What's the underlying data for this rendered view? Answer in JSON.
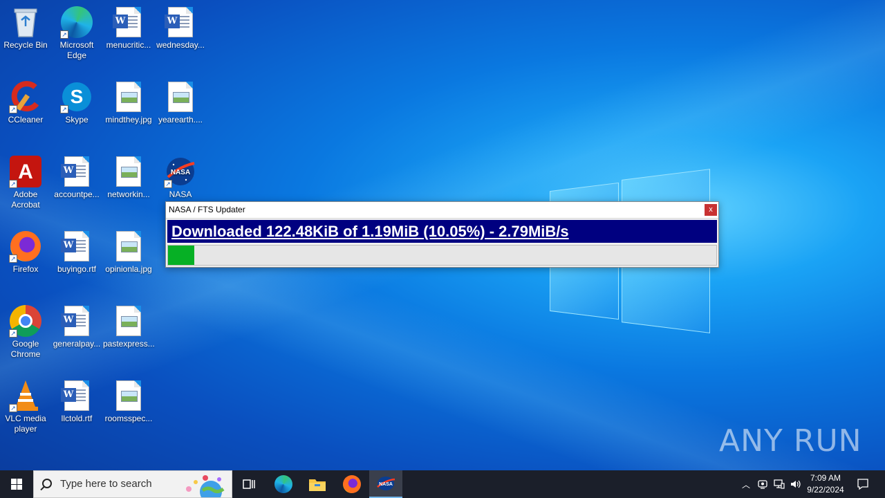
{
  "desktop": {
    "icons": [
      {
        "label": "Recycle Bin"
      },
      {
        "label": "Microsoft Edge"
      },
      {
        "label": "menucritic..."
      },
      {
        "label": "wednesday..."
      },
      {
        "label": "CCleaner"
      },
      {
        "label": "Skype"
      },
      {
        "label": "mindthey.jpg"
      },
      {
        "label": "yearearth...."
      },
      {
        "label": "Adobe Acrobat"
      },
      {
        "label": "accountpe..."
      },
      {
        "label": "networkin..."
      },
      {
        "label": "NASA"
      },
      {
        "label": "Firefox"
      },
      {
        "label": "buyingo.rtf"
      },
      {
        "label": "opinionla.jpg"
      },
      {
        "label": "Google Chrome"
      },
      {
        "label": "generalpay..."
      },
      {
        "label": "pastexpress..."
      },
      {
        "label": "VLC media player"
      },
      {
        "label": "llctold.rtf"
      },
      {
        "label": "roomsspec..."
      }
    ]
  },
  "updater": {
    "title": "NASA / FTS Updater",
    "close_label": "x",
    "status": "Downloaded 122.48KiB of 1.19MiB (10.05%) - 2.79MiB/s",
    "progress_fraction": 0.0475
  },
  "watermark": "ANY RUN",
  "taskbar": {
    "search_placeholder": "Type here to search",
    "time": "7:09 AM",
    "date": "9/22/2024"
  },
  "colors": {
    "status_bar_bg": "#000080",
    "progress_fill": "#06b025",
    "close_button": "#c83232"
  }
}
